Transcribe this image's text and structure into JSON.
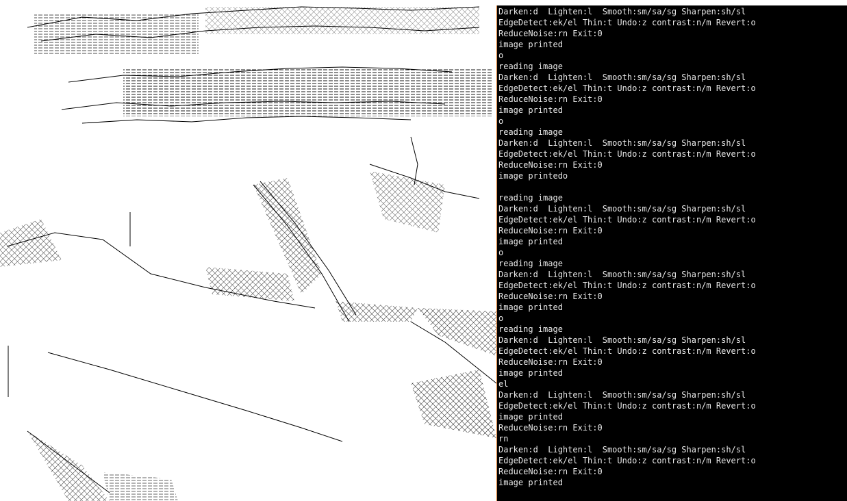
{
  "console": {
    "lines": [
      "Darken:d  Lighten:l  Smooth:sm/sa/sg Sharpen:sh/sl",
      "EdgeDetect:ek/el Thin:t Undo:z contrast:n/m Revert:o",
      "ReduceNoise:rn Exit:0",
      "image printed",
      "o",
      "reading image",
      "Darken:d  Lighten:l  Smooth:sm/sa/sg Sharpen:sh/sl",
      "EdgeDetect:ek/el Thin:t Undo:z contrast:n/m Revert:o",
      "ReduceNoise:rn Exit:0",
      "image printed",
      "o",
      "reading image",
      "Darken:d  Lighten:l  Smooth:sm/sa/sg Sharpen:sh/sl",
      "EdgeDetect:ek/el Thin:t Undo:z contrast:n/m Revert:o",
      "ReduceNoise:rn Exit:0",
      "image printedo",
      "",
      "reading image",
      "Darken:d  Lighten:l  Smooth:sm/sa/sg Sharpen:sh/sl",
      "EdgeDetect:ek/el Thin:t Undo:z contrast:n/m Revert:o",
      "ReduceNoise:rn Exit:0",
      "image printed",
      "o",
      "reading image",
      "Darken:d  Lighten:l  Smooth:sm/sa/sg Sharpen:sh/sl",
      "EdgeDetect:ek/el Thin:t Undo:z contrast:n/m Revert:o",
      "ReduceNoise:rn Exit:0",
      "image printed",
      "o",
      "reading image",
      "Darken:d  Lighten:l  Smooth:sm/sa/sg Sharpen:sh/sl",
      "EdgeDetect:ek/el Thin:t Undo:z contrast:n/m Revert:o",
      "ReduceNoise:rn Exit:0",
      "image printed",
      "el",
      "Darken:d  Lighten:l  Smooth:sm/sa/sg Sharpen:sh/sl",
      "EdgeDetect:ek/el Thin:t Undo:z contrast:n/m Revert:o",
      "image printed",
      "ReduceNoise:rn Exit:0",
      "rn",
      "Darken:d  Lighten:l  Smooth:sm/sa/sg Sharpen:sh/sl",
      "EdgeDetect:ek/el Thin:t Undo:z contrast:n/m Revert:o",
      "ReduceNoise:rn Exit:0",
      "image printed"
    ]
  },
  "colors": {
    "console_bg": "#000000",
    "console_text": "#e8e8e8",
    "console_border": "#e07a2a",
    "image_bg": "#ffffff",
    "image_edges": "#000000"
  }
}
